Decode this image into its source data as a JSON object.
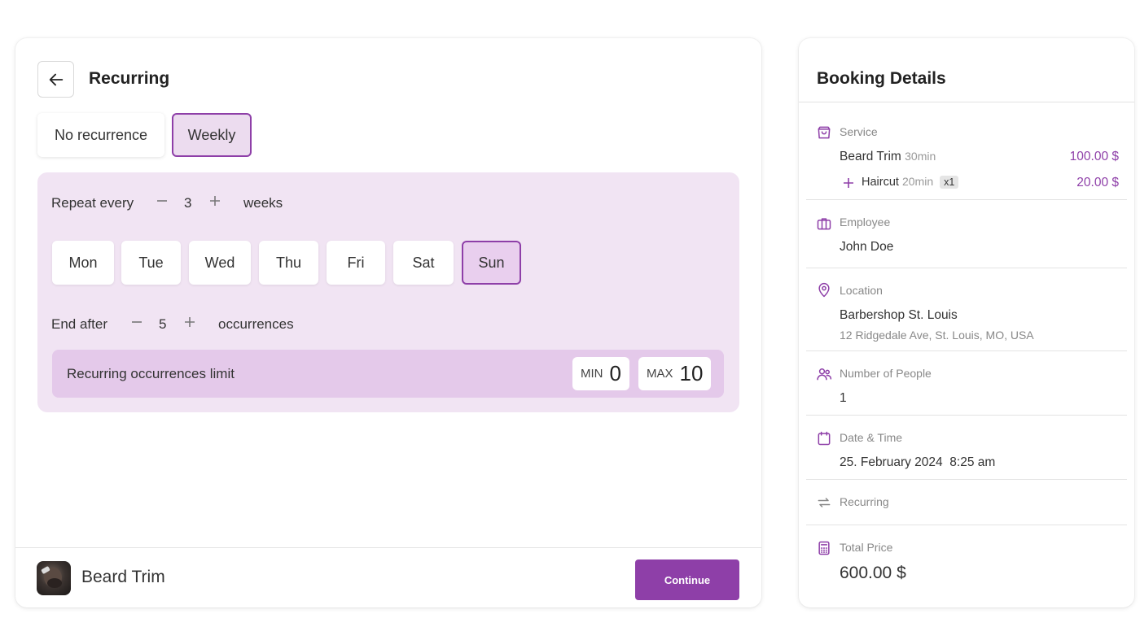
{
  "main": {
    "title": "Recurring",
    "recurrence_options": [
      {
        "label": "No recurrence",
        "selected": false
      },
      {
        "label": "Weekly",
        "selected": true
      }
    ],
    "repeat": {
      "label": "Repeat every",
      "value": "3",
      "unit": "weeks"
    },
    "days": [
      {
        "label": "Mon",
        "selected": false
      },
      {
        "label": "Tue",
        "selected": false
      },
      {
        "label": "Wed",
        "selected": false
      },
      {
        "label": "Thu",
        "selected": false
      },
      {
        "label": "Fri",
        "selected": false
      },
      {
        "label": "Sat",
        "selected": false
      },
      {
        "label": "Sun",
        "selected": true
      }
    ],
    "end_after": {
      "label": "End after",
      "value": "5",
      "unit": "occurrences"
    },
    "limit": {
      "label": "Recurring occurrences limit",
      "min_label": "MIN",
      "min_value": "0",
      "max_label": "MAX",
      "max_value": "10"
    },
    "footer": {
      "service_name": "Beard Trim",
      "continue_label": "Continue"
    }
  },
  "booking": {
    "title": "Booking Details",
    "service": {
      "label": "Service",
      "name": "Beard Trim",
      "duration": "30min",
      "price": "100.00 $",
      "extra_name": "Haircut",
      "extra_duration": "20min",
      "extra_qty": "x1",
      "extra_price": "20.00 $"
    },
    "employee": {
      "label": "Employee",
      "value": "John Doe"
    },
    "location": {
      "label": "Location",
      "name": "Barbershop St. Louis",
      "address": "12 Ridgedale Ave, St. Louis, MO, USA"
    },
    "people": {
      "label": "Number of People",
      "value": "1"
    },
    "datetime": {
      "label": "Date & Time",
      "date": "25. February 2024",
      "time": "8:25 am"
    },
    "recurring": {
      "label": "Recurring"
    },
    "total": {
      "label": "Total Price",
      "value": "600.00 $"
    }
  },
  "colors": {
    "accent": "#8e3fa8",
    "panel_bg": "#f1e4f3",
    "limit_bg": "#e4c9ea"
  },
  "icons": [
    "arrow-left-icon",
    "minus-icon",
    "plus-icon",
    "shopping-bag-icon",
    "briefcase-icon",
    "map-pin-icon",
    "users-icon",
    "calendar-icon",
    "repeat-icon",
    "calculator-icon"
  ]
}
